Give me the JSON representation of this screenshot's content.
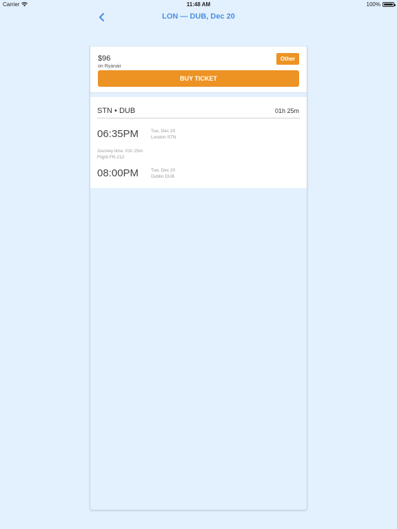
{
  "status_bar": {
    "carrier": "Carrier",
    "time": "11:48 AM",
    "battery": "100%"
  },
  "nav": {
    "title": "LON — DUB, Dec 20",
    "back_icon": "chevron-left-icon"
  },
  "offer": {
    "price": "$96",
    "source": "on Ryanair",
    "badge": "Other",
    "buy_label": "BUY TICKET"
  },
  "flight": {
    "route": "STN • DUB",
    "duration": "01h 25m",
    "departure": {
      "time": "06:35PM",
      "date": "Tue, Dec 20",
      "place": "London STN"
    },
    "journey_time": "Journey time: 01h 25m",
    "flight_number": "Flight FR-212",
    "arrival": {
      "time": "08:00PM",
      "date": "Tue, Dec 20",
      "place": "Dublin DUB"
    }
  },
  "colors": {
    "accent": "#4a90e2",
    "orange": "#ec9324",
    "background": "#e3f0fd"
  }
}
